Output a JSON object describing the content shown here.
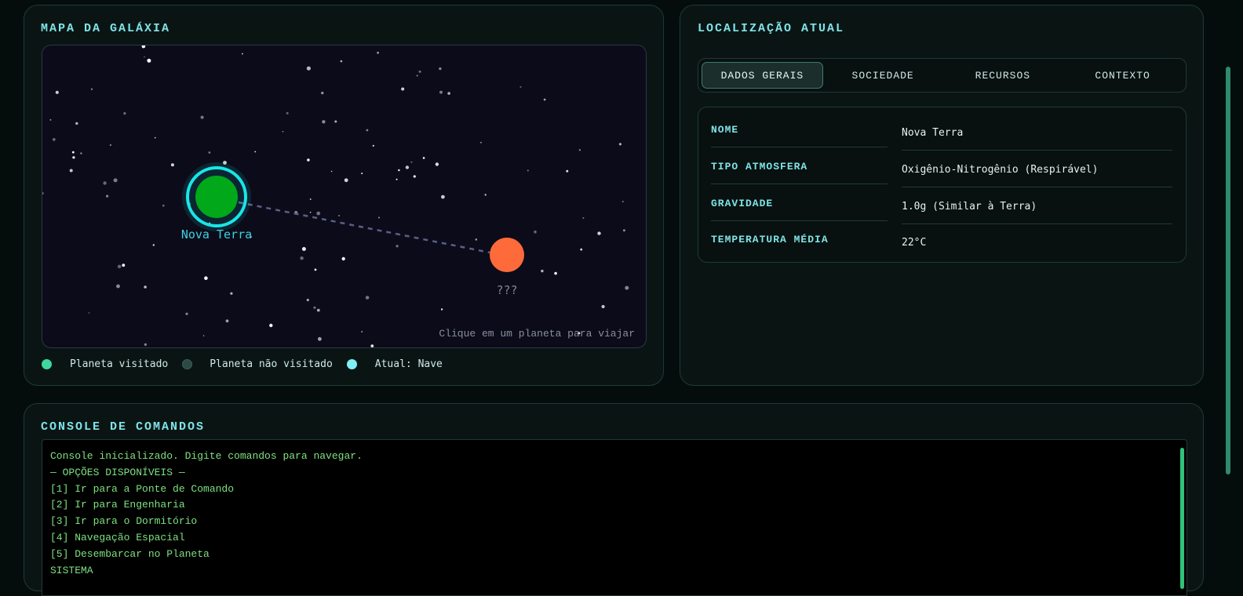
{
  "galaxy": {
    "title": "MAPA DA GALÁXIA",
    "hint": "Clique em um planeta para viajar",
    "planets": [
      {
        "name": "Nova Terra",
        "status": "current",
        "color": "#00a81a"
      },
      {
        "name": "???",
        "status": "unvisited",
        "color": "#ff6a3a"
      }
    ],
    "legend": [
      {
        "label": "Planeta visitado",
        "color": "#3fd6a0"
      },
      {
        "label": "Planeta não visitado",
        "color": "#2c4a44"
      },
      {
        "label": "Atual: Nave",
        "color": "#7ff0f5"
      }
    ]
  },
  "location": {
    "title": "LOCALIZAÇÃO ATUAL",
    "tabs": [
      {
        "label": "DADOS GERAIS",
        "active": true
      },
      {
        "label": "SOCIEDADE",
        "active": false
      },
      {
        "label": "RECURSOS",
        "active": false
      },
      {
        "label": "CONTEXTO",
        "active": false
      }
    ],
    "fields": [
      {
        "key": "NOME",
        "value": "Nova Terra"
      },
      {
        "key": "TIPO ATMOSFERA",
        "value": "Oxigênio-Nitrogênio (Respirável)"
      },
      {
        "key": "GRAVIDADE",
        "value": "1.0g (Similar à Terra)"
      },
      {
        "key": "TEMPERATURA MÉDIA",
        "value": "22°C"
      }
    ]
  },
  "console": {
    "title": "CONSOLE DE COMANDOS",
    "lines": [
      "Console inicializado. Digite comandos para navegar.",
      "— OPÇÕES DISPONÍVEIS —",
      "[1] Ir para a Ponte de Comando",
      "[2] Ir para Engenharia",
      "[3] Ir para o Dormitório",
      "[4] Navegação Espacial",
      "[5] Desembarcar no Planeta",
      "SISTEMA"
    ]
  },
  "colors": {
    "accent": "#7fe3e8",
    "console_text": "#7ee081",
    "ship_ring": "#19e6e6"
  }
}
